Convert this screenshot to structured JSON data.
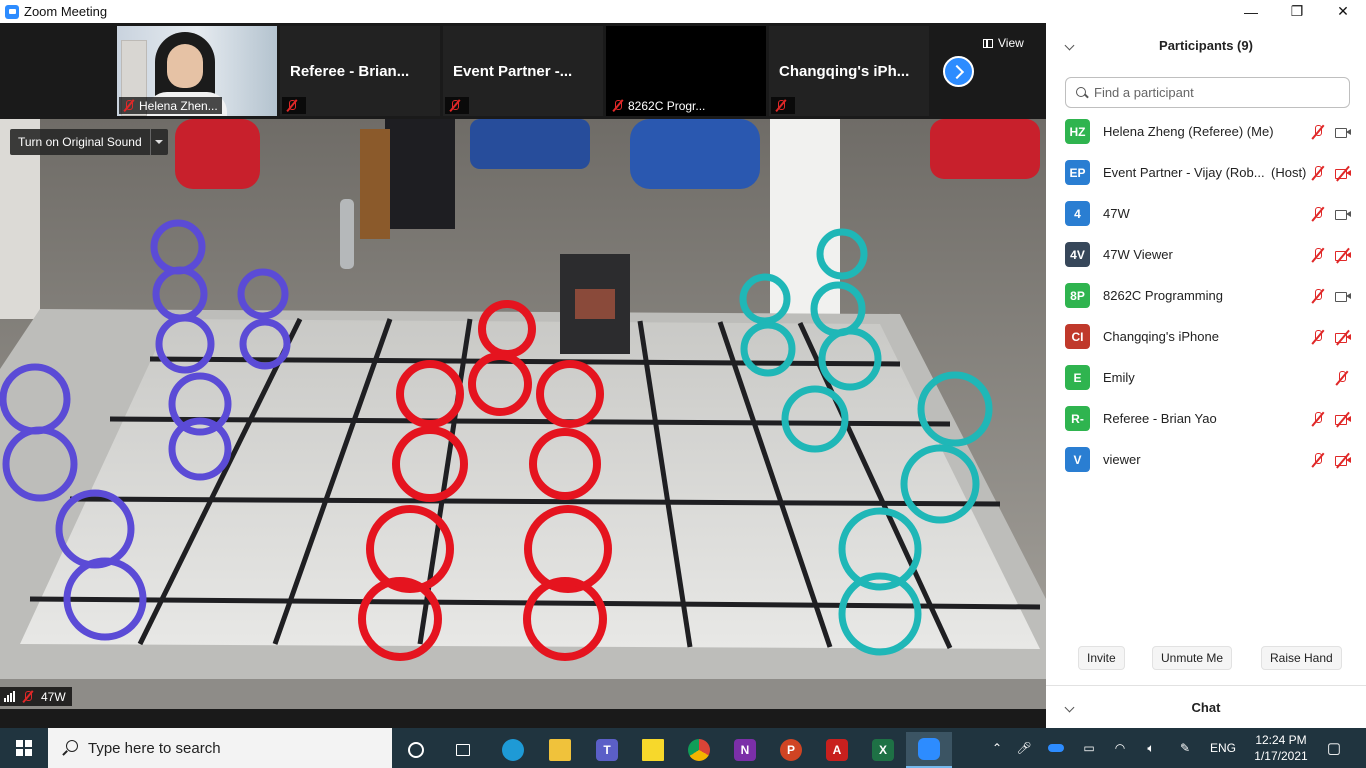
{
  "window": {
    "title": "Zoom Meeting",
    "minimize": "—",
    "maximize": "❐",
    "close": "✕"
  },
  "thumbnails": [
    {
      "name": "",
      "footer": "Helena Zhen..."
    },
    {
      "name": "Referee - Brian...",
      "footer": ""
    },
    {
      "name": "Event Partner -...",
      "footer": ""
    },
    {
      "name": "",
      "footer": "8262C Progr..."
    },
    {
      "name": "Changqing's iPh...",
      "footer": ""
    }
  ],
  "view_label": "View",
  "original_sound": "Turn on Original Sound",
  "active_speaker": "47W",
  "panel": {
    "title": "Participants (9)",
    "search_placeholder": "Find a participant",
    "participants": [
      {
        "initials": "HZ",
        "name": "Helena Zheng (Referee) (Me)",
        "tag": "",
        "color": "#2fb44f",
        "mic_muted": true,
        "video": "on"
      },
      {
        "initials": "EP",
        "name": "Event Partner - Vijay (Rob...",
        "tag": "(Host)",
        "color": "#2a7ed2",
        "mic_muted": true,
        "video": "off"
      },
      {
        "initials": "4",
        "name": "47W",
        "tag": "",
        "color": "#2a7ed2",
        "mic_muted": true,
        "video": "on"
      },
      {
        "initials": "4V",
        "name": "47W Viewer",
        "tag": "",
        "color": "#37475a",
        "mic_muted": true,
        "video": "off"
      },
      {
        "initials": "8P",
        "name": "8262C Programming",
        "tag": "",
        "color": "#2fb44f",
        "mic_muted": true,
        "video": "on"
      },
      {
        "initials": "CI",
        "name": "Changqing's iPhone",
        "tag": "",
        "color": "#c0392b",
        "mic_muted": true,
        "video": "off"
      },
      {
        "initials": "E",
        "name": "Emily",
        "tag": "",
        "color": "#2fb44f",
        "mic_muted": true,
        "video": "none"
      },
      {
        "initials": "R-",
        "name": "Referee - Brian Yao",
        "tag": "",
        "color": "#2fb44f",
        "mic_muted": true,
        "video": "off"
      },
      {
        "initials": "V",
        "name": "viewer",
        "tag": "",
        "color": "#2a7ed2",
        "mic_muted": true,
        "video": "off"
      }
    ],
    "invite": "Invite",
    "unmute": "Unmute Me",
    "raise_hand": "Raise Hand",
    "chat_title": "Chat"
  },
  "taskbar": {
    "search_text": "Type here to search",
    "apps": [
      "cortana",
      "task-view",
      "edge",
      "file-explorer",
      "teams",
      "sticky-notes",
      "chrome",
      "onenote",
      "powerpoint",
      "acrobat",
      "excel",
      "zoom"
    ],
    "language": "ENG",
    "time": "12:24 PM",
    "date": "1/17/2021"
  }
}
